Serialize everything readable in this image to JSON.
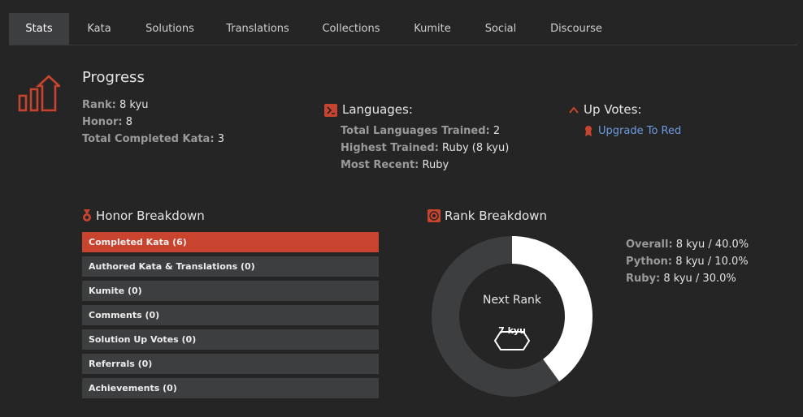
{
  "tabs": [
    {
      "label": "Stats"
    },
    {
      "label": "Kata"
    },
    {
      "label": "Solutions"
    },
    {
      "label": "Translations"
    },
    {
      "label": "Collections"
    },
    {
      "label": "Kumite"
    },
    {
      "label": "Social"
    },
    {
      "label": "Discourse"
    }
  ],
  "progress": {
    "title": "Progress",
    "rank_label": "Rank:",
    "rank_value": "8 kyu",
    "honor_label": "Honor:",
    "honor_value": "8",
    "completed_label": "Total Completed Kata:",
    "completed_value": "3"
  },
  "languages": {
    "title": "Languages:",
    "trained_label": "Total Languages Trained:",
    "trained_value": "2",
    "highest_label": "Highest Trained:",
    "highest_value": "Ruby (8 kyu)",
    "recent_label": "Most Recent:",
    "recent_value": "Ruby"
  },
  "upvotes": {
    "title": "Up Votes:",
    "link": "Upgrade To Red"
  },
  "honor_breakdown": {
    "title": "Honor Breakdown",
    "items": [
      {
        "label": "Completed Kata (6)"
      },
      {
        "label": "Authored Kata & Translations (0)"
      },
      {
        "label": "Kumite (0)"
      },
      {
        "label": "Comments (0)"
      },
      {
        "label": "Solution Up Votes (0)"
      },
      {
        "label": "Referrals (0)"
      },
      {
        "label": "Achievements (0)"
      }
    ]
  },
  "rank_breakdown": {
    "title": "Rank Breakdown",
    "next_rank_label": "Next Rank",
    "next_rank_value": "7 kyu",
    "progress_fraction": 0.4,
    "rows": [
      {
        "label": "Overall:",
        "value": "8 kyu / 40.0%"
      },
      {
        "label": "Python:",
        "value": "8 kyu / 10.0%"
      },
      {
        "label": "Ruby:",
        "value": "8 kyu / 30.0%"
      }
    ]
  },
  "colors": {
    "accent": "#c9442e",
    "link": "#6d9be0",
    "ring_track": "#3d3e40",
    "ring_fill": "#ffffff"
  }
}
